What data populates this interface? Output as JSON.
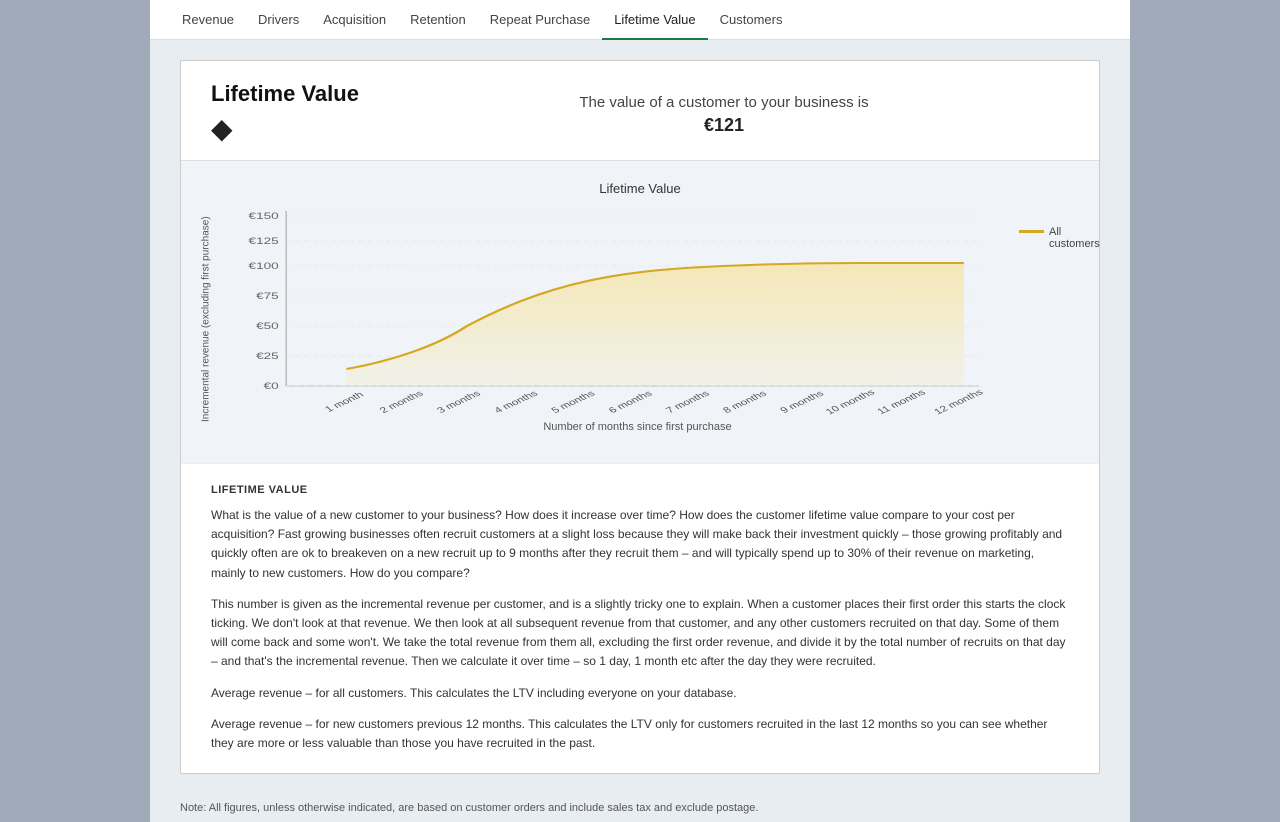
{
  "nav": {
    "items": [
      {
        "label": "Revenue",
        "active": false
      },
      {
        "label": "Drivers",
        "active": false
      },
      {
        "label": "Acquisition",
        "active": false
      },
      {
        "label": "Retention",
        "active": false
      },
      {
        "label": "Repeat Purchase",
        "active": false
      },
      {
        "label": "Lifetime Value",
        "active": true
      },
      {
        "label": "Customers",
        "active": false
      }
    ]
  },
  "header": {
    "title": "Lifetime Value",
    "diamond": "◆",
    "value_text": "The value of a customer to your business is",
    "value_amount": "€121"
  },
  "chart": {
    "title": "Lifetime Value",
    "y_axis_label": "Incremental revenue (excluding first purchase)",
    "x_axis_label": "Number of months since first purchase",
    "x_labels": [
      "1 month",
      "2 months",
      "3 months",
      "4 months",
      "5 months",
      "6 months",
      "7 months",
      "8 months",
      "9 months",
      "10 months",
      "11 months",
      "12 months"
    ],
    "y_labels": [
      "€0",
      "€25",
      "€50",
      "€75",
      "€100",
      "€125",
      "€150"
    ],
    "legend_label": "All customers",
    "legend_color": "#d4a820"
  },
  "info": {
    "section_title": "LIFETIME VALUE",
    "paragraphs": [
      "What is the value of a new customer to your business? How does it increase over time? How does the customer lifetime value compare to your cost per acquisition? Fast growing businesses often recruit customers at a slight loss because they will make back their investment quickly – those growing profitably and quickly often are ok to breakeven on a new recruit up to 9 months after they recruit them – and will typically spend up to 30% of their revenue on marketing, mainly to new customers. How do you compare?",
      "This number is given as the incremental revenue per customer, and is a slightly tricky one to explain. When a customer places their first order this starts the clock ticking. We don't look at that revenue. We then look at all subsequent revenue from that customer, and any other customers recruited on that day. Some of them will come back and some won't. We take the total revenue from them all, excluding the first order revenue, and divide it by the total number of recruits on that day – and that's the incremental revenue. Then we calculate it over time – so 1 day, 1 month etc after the day they were recruited.",
      "Average revenue – for all customers. This calculates the LTV including everyone on your database.",
      "Average revenue – for new customers previous 12 months. This calculates the LTV only for customers recruited in the last 12 months so you can see whether they are more or less valuable than those you have recruited in the past."
    ]
  },
  "note": "Note: All figures, unless otherwise indicated, are based on customer orders and include sales tax and exclude postage."
}
